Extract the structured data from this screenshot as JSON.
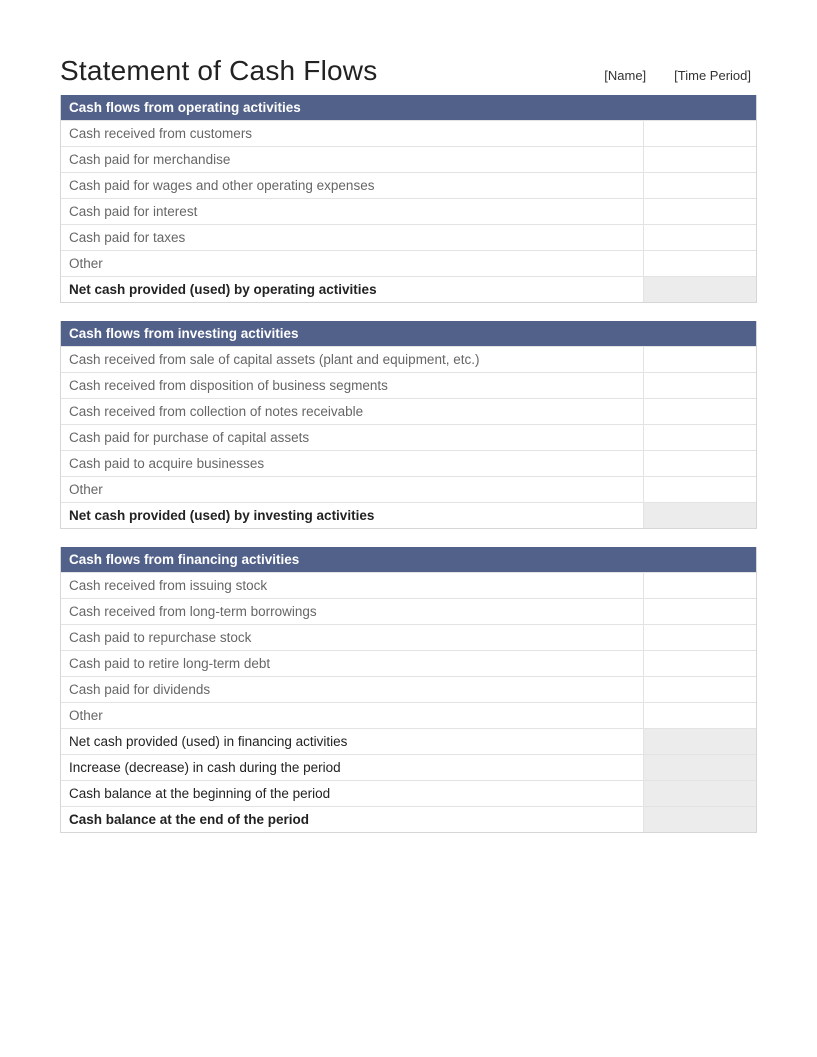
{
  "title": "Statement of Cash Flows",
  "meta": {
    "name": "[Name]",
    "period": "[Time Period]"
  },
  "sections": [
    {
      "header": "Cash flows from operating activities",
      "rows": [
        {
          "label": "Cash received from customers",
          "value": "",
          "type": "item"
        },
        {
          "label": "Cash paid for merchandise",
          "value": "",
          "type": "item"
        },
        {
          "label": "Cash paid for wages and other operating expenses",
          "value": "",
          "type": "item"
        },
        {
          "label": "Cash paid for interest",
          "value": "",
          "type": "item"
        },
        {
          "label": "Cash paid for taxes",
          "value": "",
          "type": "item"
        },
        {
          "label": "Other",
          "value": "",
          "type": "item"
        },
        {
          "label": "Net cash provided (used) by operating activities",
          "value": "",
          "type": "summary-bold"
        }
      ]
    },
    {
      "header": "Cash flows from investing activities",
      "rows": [
        {
          "label": "Cash received from sale of capital assets (plant and equipment, etc.)",
          "value": "",
          "type": "item"
        },
        {
          "label": "Cash received from disposition of business segments",
          "value": "",
          "type": "item"
        },
        {
          "label": "Cash received from collection of notes receivable",
          "value": "",
          "type": "item"
        },
        {
          "label": "Cash paid for purchase of capital assets",
          "value": "",
          "type": "item"
        },
        {
          "label": "Cash paid to acquire businesses",
          "value": "",
          "type": "item"
        },
        {
          "label": "Other",
          "value": "",
          "type": "item"
        },
        {
          "label": "Net cash provided (used) by investing activities",
          "value": "",
          "type": "summary-bold"
        }
      ]
    },
    {
      "header": "Cash flows from financing activities",
      "rows": [
        {
          "label": "Cash received from issuing stock",
          "value": "",
          "type": "item"
        },
        {
          "label": "Cash received from long-term borrowings",
          "value": "",
          "type": "item"
        },
        {
          "label": "Cash paid to repurchase stock",
          "value": "",
          "type": "item"
        },
        {
          "label": "Cash paid to retire long-term debt",
          "value": "",
          "type": "item"
        },
        {
          "label": "Cash paid for dividends",
          "value": "",
          "type": "item"
        },
        {
          "label": "Other",
          "value": "",
          "type": "item"
        },
        {
          "label": "Net cash provided (used) in financing activities",
          "value": "",
          "type": "summary-shade"
        },
        {
          "label": "Increase (decrease) in cash during the period",
          "value": "",
          "type": "summary-shade"
        },
        {
          "label": "Cash balance at the beginning of the period",
          "value": "",
          "type": "summary-plain"
        },
        {
          "label": "Cash balance at the end of the period",
          "value": "",
          "type": "summary-bold"
        }
      ]
    }
  ]
}
